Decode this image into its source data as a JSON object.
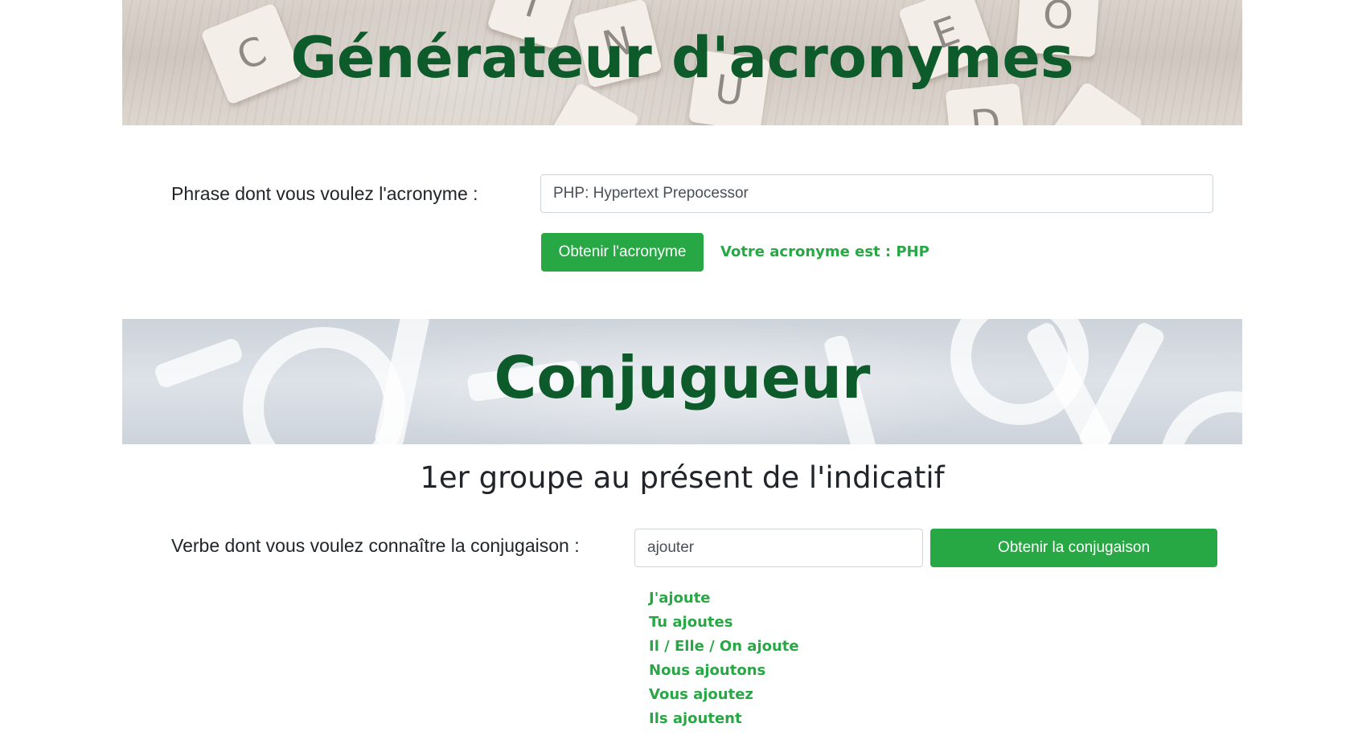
{
  "acronym_section": {
    "title": "Générateur d'acronymes",
    "label": "Phrase dont vous voulez l'acronyme :",
    "input_value": "PHP: Hypertext Prepocessor",
    "button_label": "Obtenir l'acronyme",
    "result": "Votre acronyme est : PHP",
    "banner_tiles": [
      "C",
      "T",
      "N",
      "U",
      "E",
      "O",
      "D"
    ]
  },
  "conjugation_section": {
    "title": "Conjugueur",
    "subtitle": "1er groupe au présent de l'indicatif",
    "label": "Verbe dont vous voulez connaître la conjugaison :",
    "input_value": "ajouter",
    "button_label": "Obtenir la conjugaison",
    "results": [
      "J'ajoute",
      "Tu ajoutes",
      "Il / Elle / On ajoute",
      "Nous ajoutons",
      "Vous ajoutez",
      "Ils ajoutent"
    ]
  },
  "colors": {
    "title_green": "#0d5a2a",
    "accent_green": "#28a745"
  }
}
